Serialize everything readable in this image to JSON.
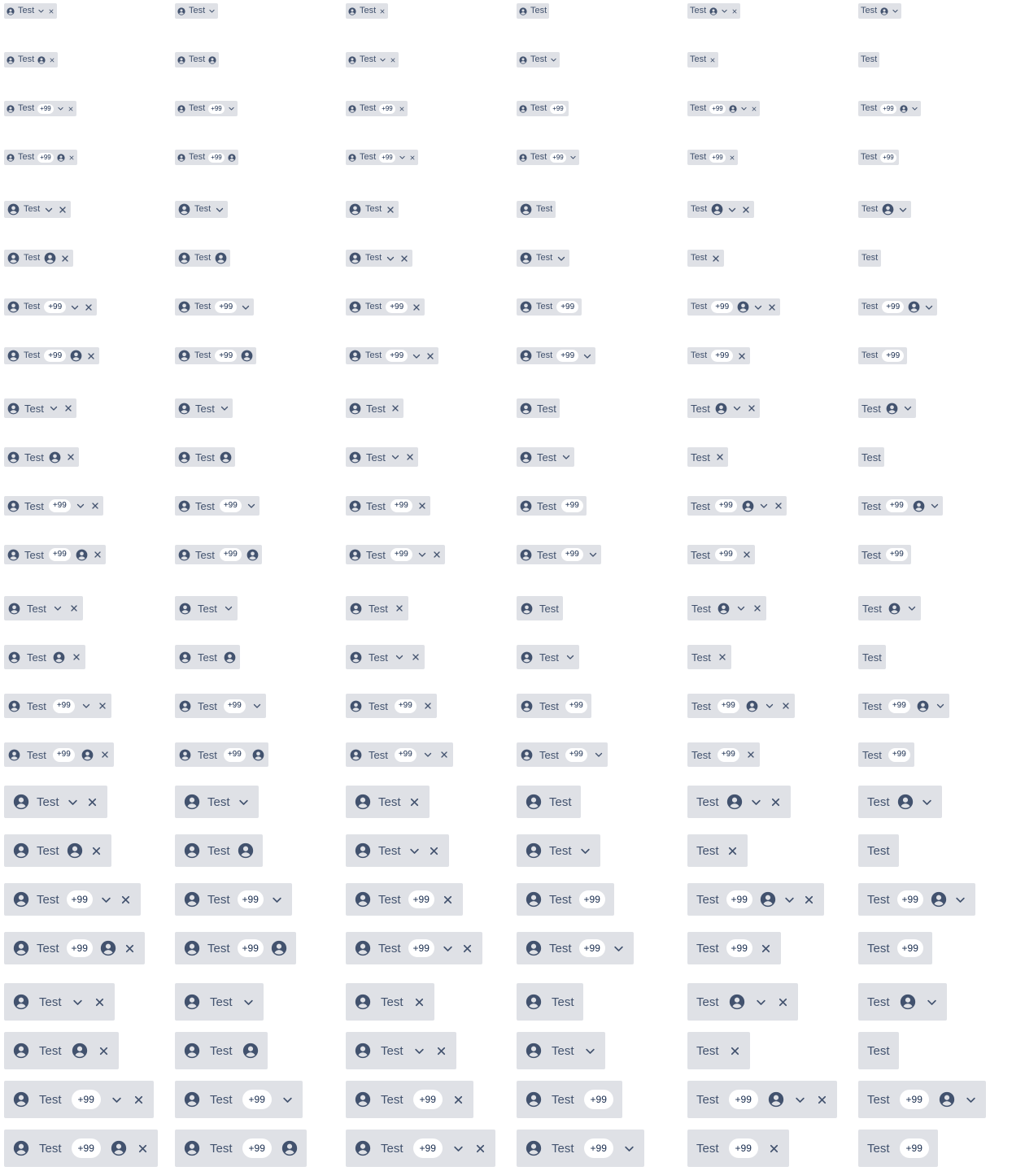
{
  "tag": {
    "label": "Test",
    "badge": "+99"
  },
  "colors": {
    "background": "#dfe1e6",
    "text": "#42526e",
    "badge_bg": "#ffffff",
    "badge_text": "#172b4d"
  },
  "icons": {
    "avatar": "person-circle-icon",
    "dropdown": "chevron-down-icon",
    "remove": "close-icon"
  },
  "grid": {
    "columns": [
      {
        "icon_before": true,
        "dropdown": true,
        "remove": true
      },
      {
        "icon_before": true,
        "dropdown": true,
        "remove": false
      },
      {
        "icon_before": true,
        "dropdown": false,
        "remove": true
      },
      {
        "icon_before": true,
        "dropdown": false,
        "remove": false
      },
      {
        "icon_before": false,
        "dropdown": true,
        "remove": true
      },
      {
        "icon_before": false,
        "dropdown": true,
        "remove": false
      }
    ],
    "row_variants": [
      {
        "badge": false,
        "icon_after_label": false
      },
      {
        "badge": false,
        "icon_after_label": true
      },
      {
        "badge": true,
        "icon_after_label": false
      },
      {
        "badge": true,
        "icon_after_label": true
      }
    ],
    "sizes": [
      "xs",
      "sm",
      "md",
      "lg",
      "xl",
      "xxl"
    ]
  }
}
